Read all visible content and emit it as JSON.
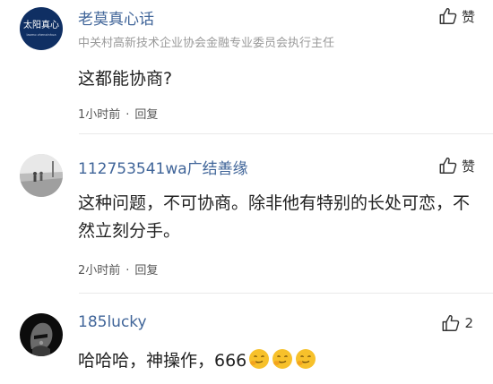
{
  "comments": [
    {
      "username": "老莫真心话",
      "user_title": "中关村高新技术企业协会金融专业委员会执行主任",
      "avatar_text": "太阳真心",
      "avatar_subtext": "laomo zhenxinhua",
      "text": "这都能协商?",
      "time": "1小时前",
      "separator": "·",
      "reply_label": "回复",
      "like_label": "赞"
    },
    {
      "username": "112753541wa广结善缘",
      "text": "这种问题，不可协商。除非他有特别的长处可恋，不然立刻分手。",
      "time": "2小时前",
      "separator": "·",
      "reply_label": "回复",
      "like_label": "赞"
    },
    {
      "username": "185lucky",
      "text": "哈哈哈，神操作，666",
      "like_count": "2"
    }
  ],
  "icons": {
    "like": "thumbs-up-icon",
    "emoji": "smirk-emoji-icon"
  },
  "colors": {
    "username": "#406599",
    "secondary_text": "#9a9a9a",
    "body_text": "#222222",
    "avatar_1_bg": "#0f2f63"
  }
}
